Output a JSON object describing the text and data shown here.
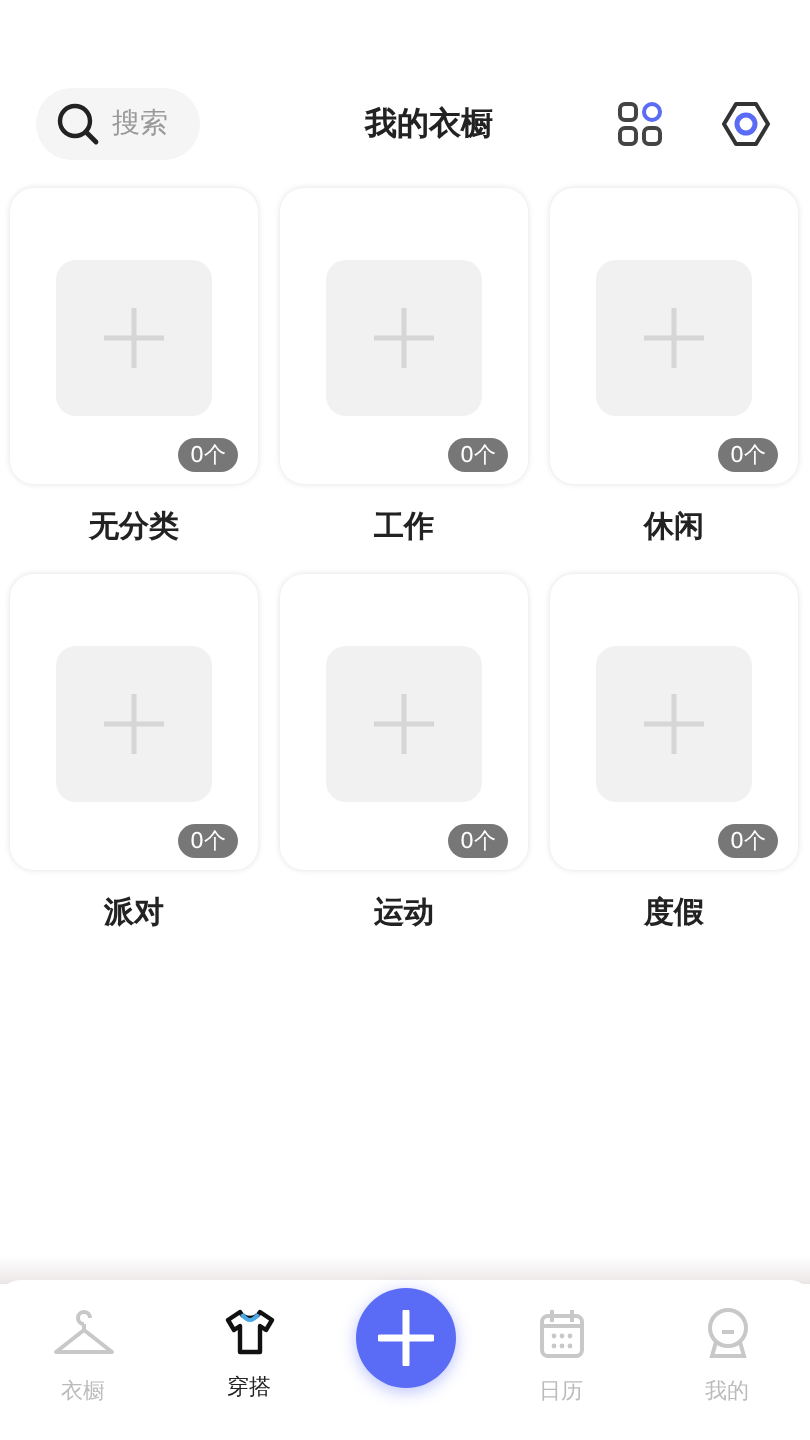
{
  "header": {
    "search": {
      "placeholder": "搜索"
    },
    "title": "我的衣橱"
  },
  "categories": [
    {
      "name": "无分类",
      "count": "0个"
    },
    {
      "name": "工作",
      "count": "0个"
    },
    {
      "name": "休闲",
      "count": "0个"
    },
    {
      "name": "派对",
      "count": "0个"
    },
    {
      "name": "运动",
      "count": "0个"
    },
    {
      "name": "度假",
      "count": "0个"
    }
  ],
  "tab_bar": [
    {
      "kind": "hanger",
      "label": "衣橱",
      "selected": false
    },
    {
      "kind": "shirt",
      "label": "穿搭",
      "selected": true
    },
    {
      "kind": "add"
    },
    {
      "kind": "calendar",
      "label": "日历",
      "selected": false
    },
    {
      "kind": "person",
      "label": "我的",
      "selected": false
    }
  ]
}
